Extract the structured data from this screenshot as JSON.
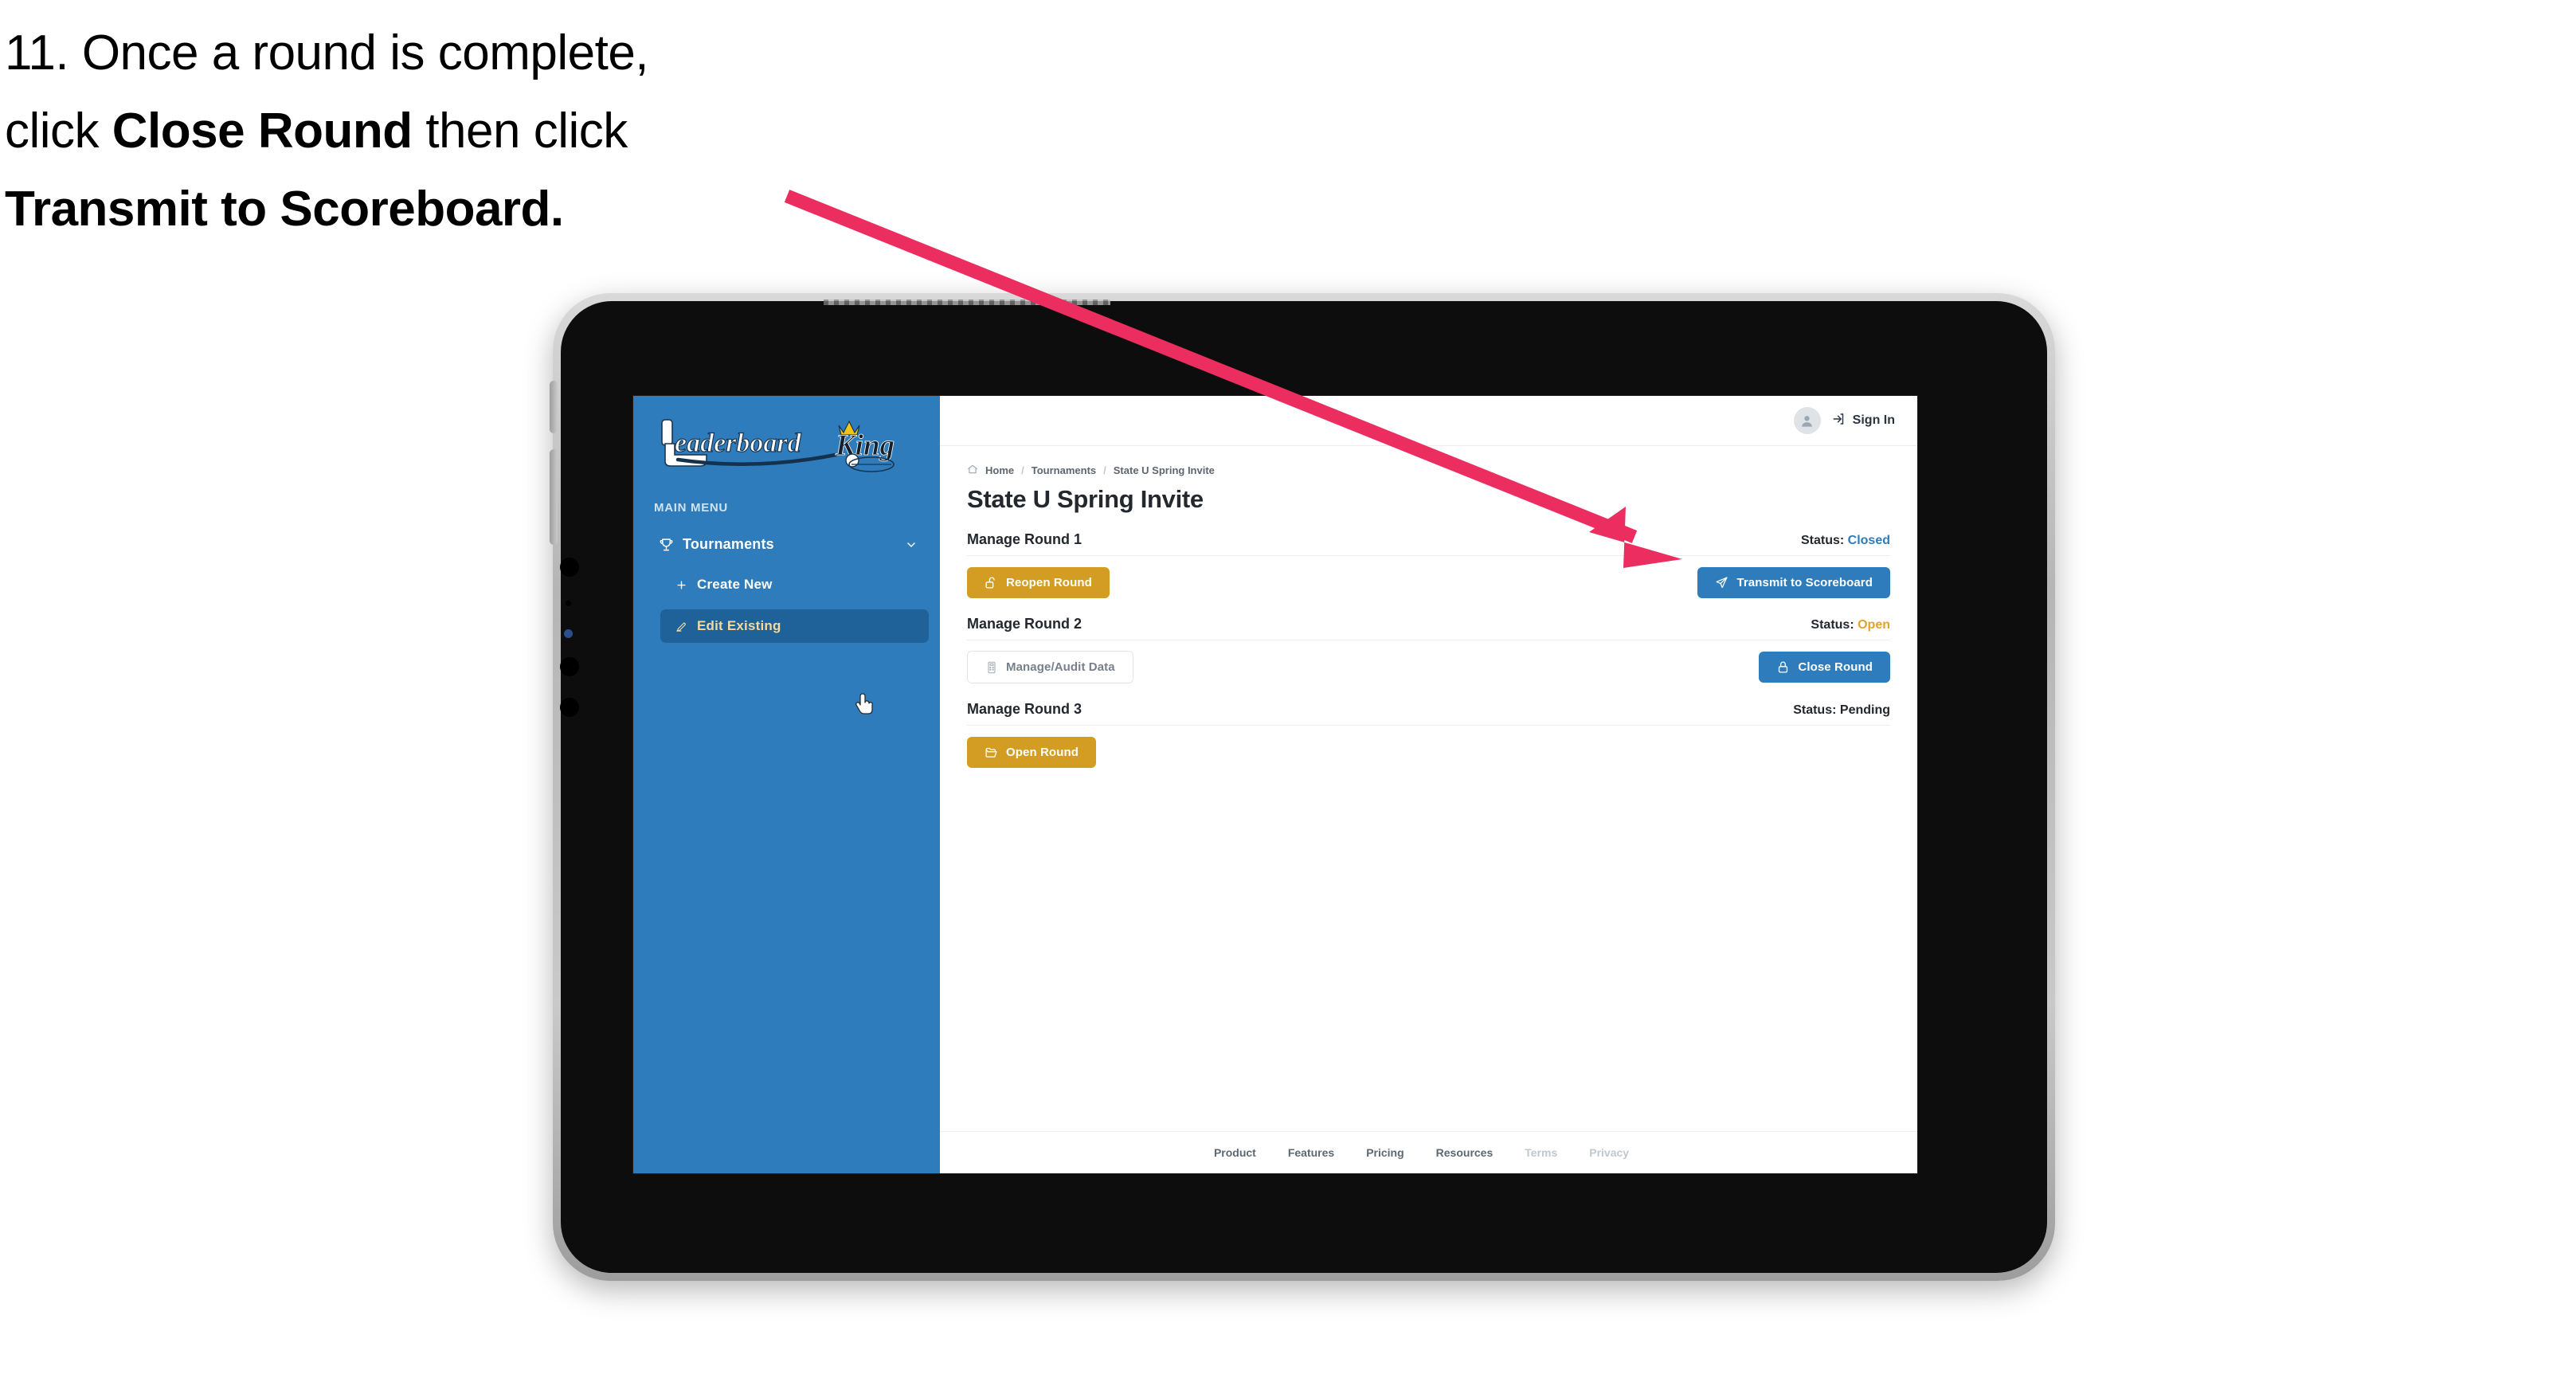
{
  "caption": {
    "line1_prefix": "11. Once a round is complete,",
    "line2_prefix": "click ",
    "line2_bold": "Close Round",
    "line2_suffix": " then click",
    "line3_bold": "Transmit to Scoreboard."
  },
  "annotation": {
    "arrow_color": "#EB2D5F",
    "points_to": "Transmit to Scoreboard"
  },
  "app": {
    "sidebar": {
      "logo_text_primary": "Leaderboard",
      "logo_text_secondary": "King",
      "section_label": "MAIN MENU",
      "items": [
        {
          "label": "Tournaments",
          "icon": "trophy-icon",
          "chevron": "chevron-down-icon",
          "active": false
        },
        {
          "label": "Create New",
          "icon": "plus-icon",
          "active": false
        },
        {
          "label": "Edit Existing",
          "icon": "pencil-square-icon",
          "active": true
        }
      ],
      "background_color": "#2E7CBB",
      "active_background_color": "#1F6199",
      "active_text_color": "#F3D9A0"
    },
    "topbar": {
      "avatar_icon": "user-avatar-icon",
      "signin_icon": "sign-in-arrow-icon",
      "signin_label": "Sign In"
    },
    "breadcrumb": {
      "home_icon": "home-icon",
      "items": [
        "Home",
        "Tournaments",
        "State U Spring Invite"
      ],
      "separator": "/"
    },
    "page_title": "State U Spring Invite",
    "rounds": [
      {
        "name": "Manage Round 1",
        "status_label": "Status:",
        "status_value": "Closed",
        "status_style": "closed",
        "left_button": {
          "label": "Reopen Round",
          "icon": "unlock-icon",
          "style": "gold"
        },
        "right_button": {
          "label": "Transmit to Scoreboard",
          "icon": "paper-plane-icon",
          "style": "blue"
        }
      },
      {
        "name": "Manage Round 2",
        "status_label": "Status:",
        "status_value": "Open",
        "status_style": "open",
        "left_button": {
          "label": "Manage/Audit Data",
          "icon": "calculator-icon",
          "style": "ghost"
        },
        "right_button": {
          "label": "Close Round",
          "icon": "lock-icon",
          "style": "blue"
        }
      },
      {
        "name": "Manage Round 3",
        "status_label": "Status:",
        "status_value": "Pending",
        "status_style": "pending",
        "left_button": {
          "label": "Open Round",
          "icon": "folder-open-icon",
          "style": "gold"
        },
        "right_button": null
      }
    ],
    "footer": {
      "links": [
        {
          "label": "Product",
          "muted": false
        },
        {
          "label": "Features",
          "muted": false
        },
        {
          "label": "Pricing",
          "muted": false
        },
        {
          "label": "Resources",
          "muted": false
        },
        {
          "label": "Terms",
          "muted": true
        },
        {
          "label": "Privacy",
          "muted": true
        }
      ]
    },
    "colors": {
      "brand_blue": "#2E7CBB",
      "brand_gold": "#D39D24",
      "status_open": "#E0A32B",
      "text_dark": "#23272E"
    }
  }
}
